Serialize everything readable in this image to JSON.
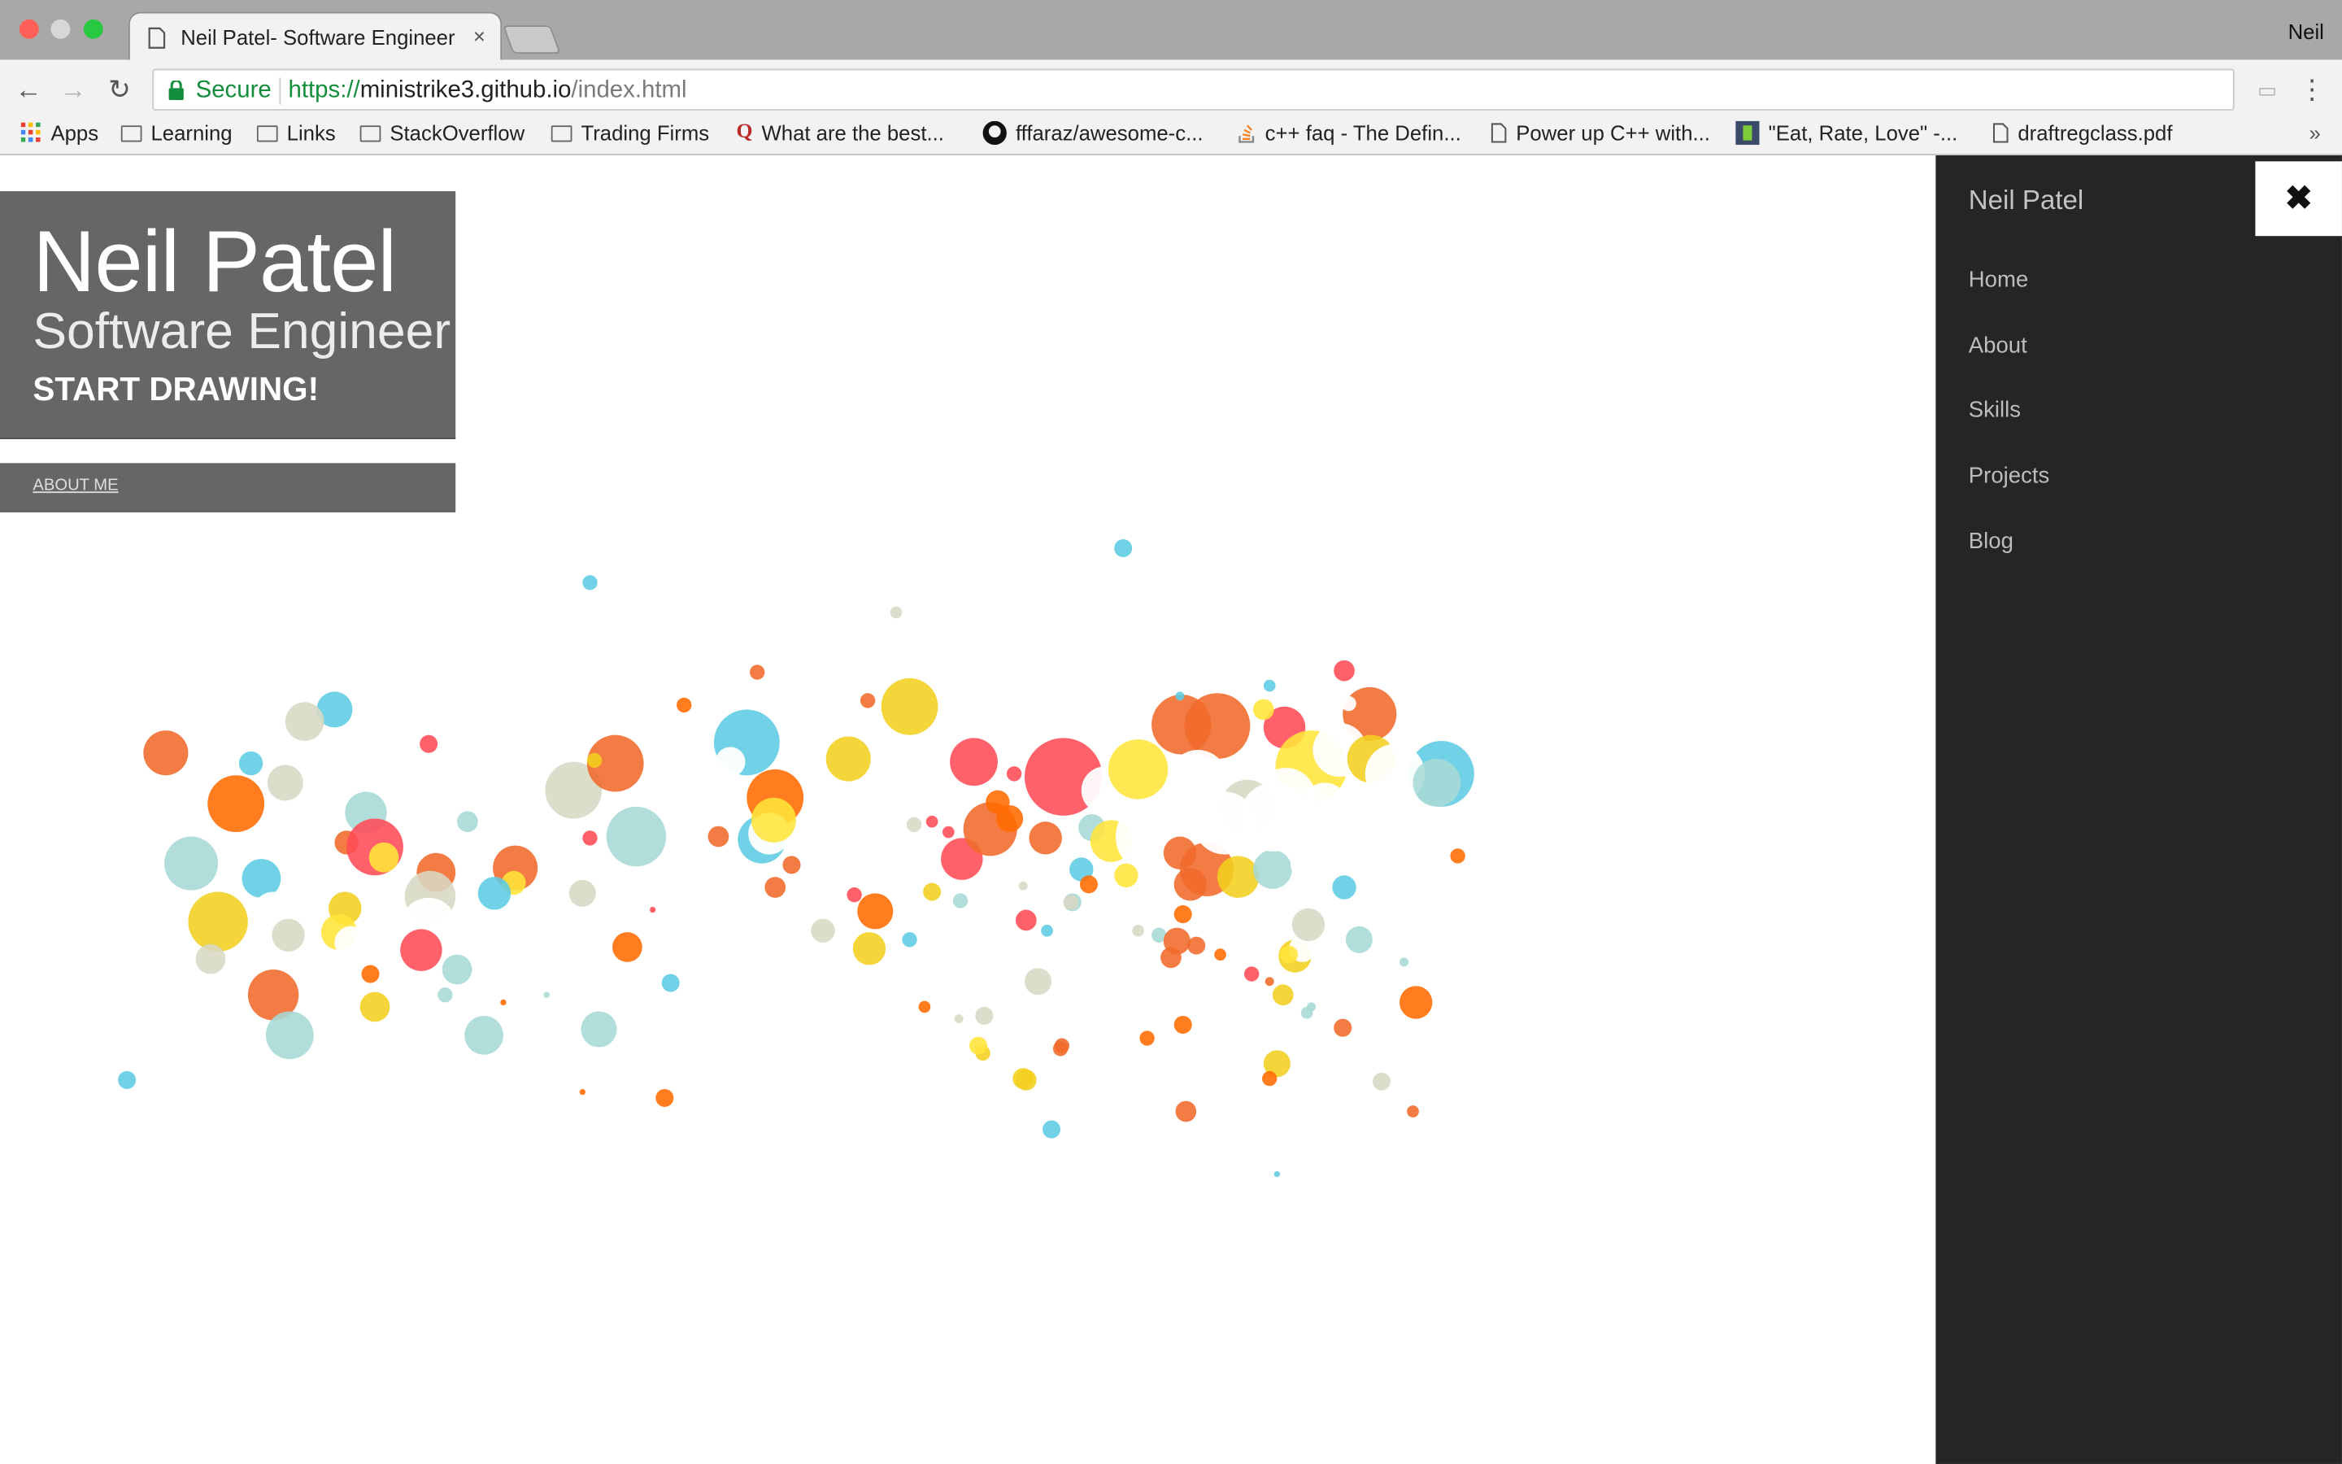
{
  "browser": {
    "tab_title": "Neil Patel- Software Engineer",
    "tab_close": "×",
    "profile_name": "Neil",
    "secure_label": "Secure",
    "url_protocol": "https://",
    "url_host": "ministrike3.github.io",
    "url_path": "/index.html",
    "bookmarks": [
      {
        "label": "Apps",
        "icon": "apps-grid-icon"
      },
      {
        "label": "Learning",
        "icon": "folder-icon"
      },
      {
        "label": "Links",
        "icon": "folder-icon"
      },
      {
        "label": "StackOverflow",
        "icon": "folder-icon"
      },
      {
        "label": "Trading Firms",
        "icon": "folder-icon"
      },
      {
        "label": "What are the best...",
        "icon": "quora-icon"
      },
      {
        "label": "fffaraz/awesome-c...",
        "icon": "github-icon"
      },
      {
        "label": "c++ faq - The Defin...",
        "icon": "stackoverflow-icon"
      },
      {
        "label": "Power up C++ with...",
        "icon": "page-icon"
      },
      {
        "label": "\"Eat, Rate, Love\" -...",
        "icon": "site-icon"
      },
      {
        "label": "draftregclass.pdf",
        "icon": "page-icon"
      }
    ],
    "overflow": "»"
  },
  "hero": {
    "name": "Neil Patel",
    "subtitle": "Software Engineer",
    "cta": "START DRAWING!"
  },
  "about": {
    "link_label": "ABOUT ME"
  },
  "sidebar": {
    "title": "Neil Patel",
    "close_glyph": "✖",
    "items": [
      {
        "label": "Home"
      },
      {
        "label": "About"
      },
      {
        "label": "Skills"
      },
      {
        "label": "Projects"
      },
      {
        "label": "Blog"
      }
    ]
  },
  "canvas": {
    "palette": [
      "#f16a2b",
      "#ff6a00",
      "#f2cf1f",
      "#ffe53a",
      "#5ccbe4",
      "#a6d9d6",
      "#ff4b57",
      "#d8d8c4",
      "#ffffff"
    ]
  }
}
